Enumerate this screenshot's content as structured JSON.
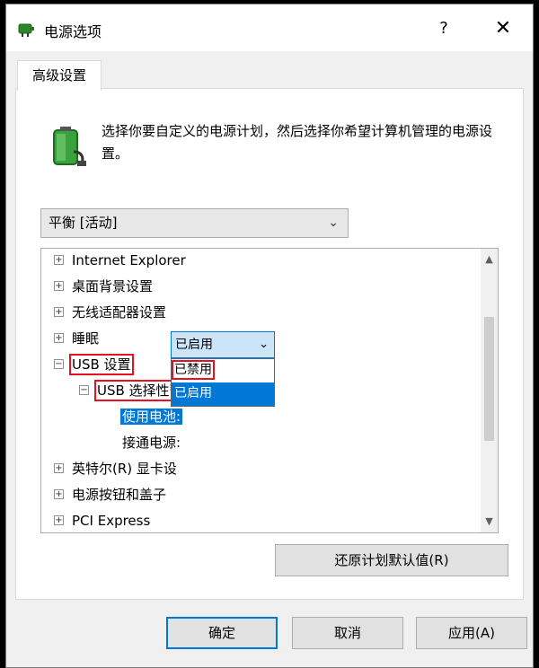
{
  "window": {
    "title": "电源选项",
    "help_label": "?",
    "close_label": "✕"
  },
  "tab": {
    "label": "高级设置"
  },
  "description": "选择你要自定义的电源计划，然后选择你希望计算机管理的电源设置。",
  "plan_select": {
    "value": "平衡 [活动]",
    "chevron": "⌄"
  },
  "tree": {
    "items": [
      {
        "expander": "+",
        "label": "Internet Explorer"
      },
      {
        "expander": "+",
        "label": "桌面背景设置"
      },
      {
        "expander": "+",
        "label": "无线适配器设置"
      },
      {
        "expander": "+",
        "label": "睡眠"
      },
      {
        "expander": "−",
        "label": "USB 设置"
      },
      {
        "expander": "−",
        "label": "USB 选择性暂停设置"
      },
      {
        "label": "使用电池:"
      },
      {
        "label": "接通电源:"
      },
      {
        "expander": "+",
        "label": "英特尔(R) 显卡设"
      },
      {
        "expander": "+",
        "label": "电源按钮和盖子"
      },
      {
        "expander": "+",
        "label": "PCI Express"
      }
    ],
    "scroll_up": "▲",
    "scroll_down": "▼"
  },
  "battery_dropdown": {
    "value": "已启用",
    "chevron": "⌄",
    "options": [
      "已禁用",
      "已启用"
    ],
    "selected_index": 1
  },
  "buttons": {
    "restore": "还原计划默认值(R)",
    "ok": "确定",
    "cancel": "取消",
    "apply": "应用(A)"
  },
  "colors": {
    "accent": "#0078d7",
    "highlight_outline": "#e81123"
  }
}
